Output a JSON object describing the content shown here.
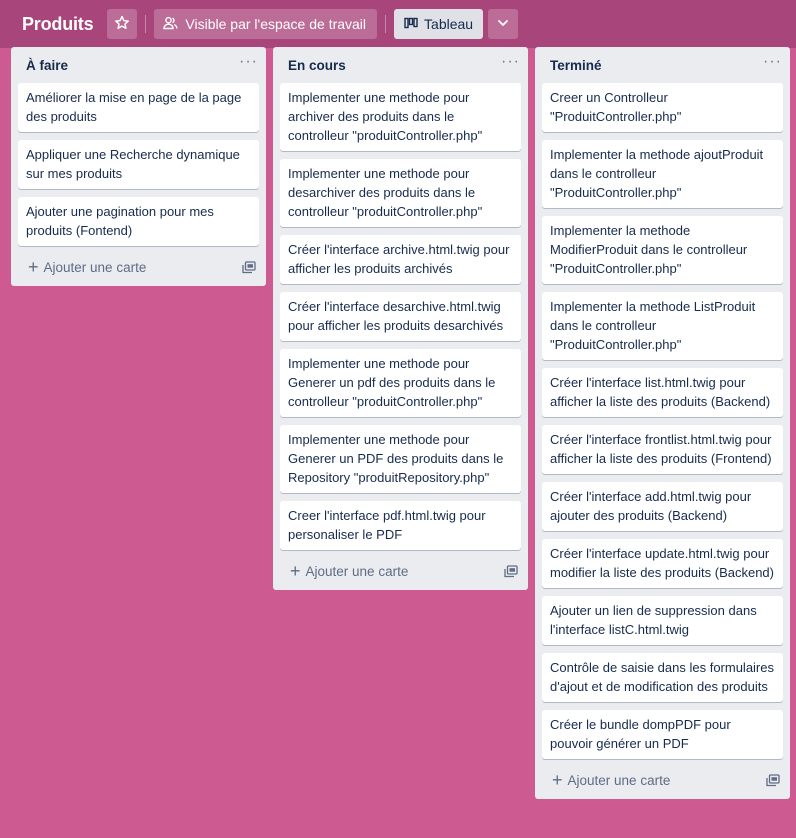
{
  "header": {
    "board_title": "Produits",
    "visibility_label": "Visible par l'espace de travail",
    "view_label": "Tableau"
  },
  "lists": [
    {
      "title": "À faire",
      "cards": [
        "Améliorer la mise en page de la page des produits",
        "Appliquer une Recherche dynamique sur mes produits",
        "Ajouter une pagination pour mes produits (Fontend)"
      ],
      "add_label": "Ajouter une carte"
    },
    {
      "title": "En cours",
      "cards": [
        "Implementer une methode pour archiver des produits dans le controlleur \"produitController.php\"",
        "Implementer une methode pour desarchiver des produits dans le controlleur \"produitController.php\"",
        "Créer l'interface archive.html.twig pour afficher les produits archivés",
        "Créer l'interface desarchive.html.twig pour afficher les produits desarchivés",
        "Implementer une methode pour Generer un pdf des produits dans le controlleur \"produitController.php\"",
        "Implementer une methode pour Generer un PDF des produits dans le Repository \"produitRepository.php\"",
        "Creer l'interface pdf.html.twig pour personaliser le PDF"
      ],
      "add_label": "Ajouter une carte"
    },
    {
      "title": "Terminé",
      "cards": [
        "Creer un Controlleur \"ProduitController.php\"",
        "Implementer la methode ajoutProduit dans le controlleur \"ProduitController.php\"",
        "Implementer la methode ModifierProduit dans le controlleur \"ProduitController.php\"",
        "Implementer la methode ListProduit dans le controlleur \"ProduitController.php\"",
        "Créer l'interface list.html.twig pour afficher la liste des produits (Backend)",
        "Créer l'interface frontlist.html.twig pour afficher la liste des produits (Frontend)",
        "Créer l'interface add.html.twig pour ajouter des produits (Backend)",
        "Créer l'interface update.html.twig pour modifier la liste des produits (Backend)",
        "Ajouter un lien de suppression dans l'interface listC.html.twig",
        "Contrôle de saisie dans les formulaires d'ajout et de modification des produits",
        "Créer le bundle dompPDF pour pouvoir générer un PDF"
      ],
      "add_label": "Ajouter une carte"
    }
  ],
  "colors": {
    "board_background": "#cd5a91",
    "header_background": "#a8457a",
    "list_background": "#ebecf0",
    "card_background": "#ffffff"
  },
  "icons": [
    "star-icon",
    "users-icon",
    "board-icon",
    "chevron-down-icon",
    "more-icon",
    "plus-icon",
    "template-icon"
  ]
}
